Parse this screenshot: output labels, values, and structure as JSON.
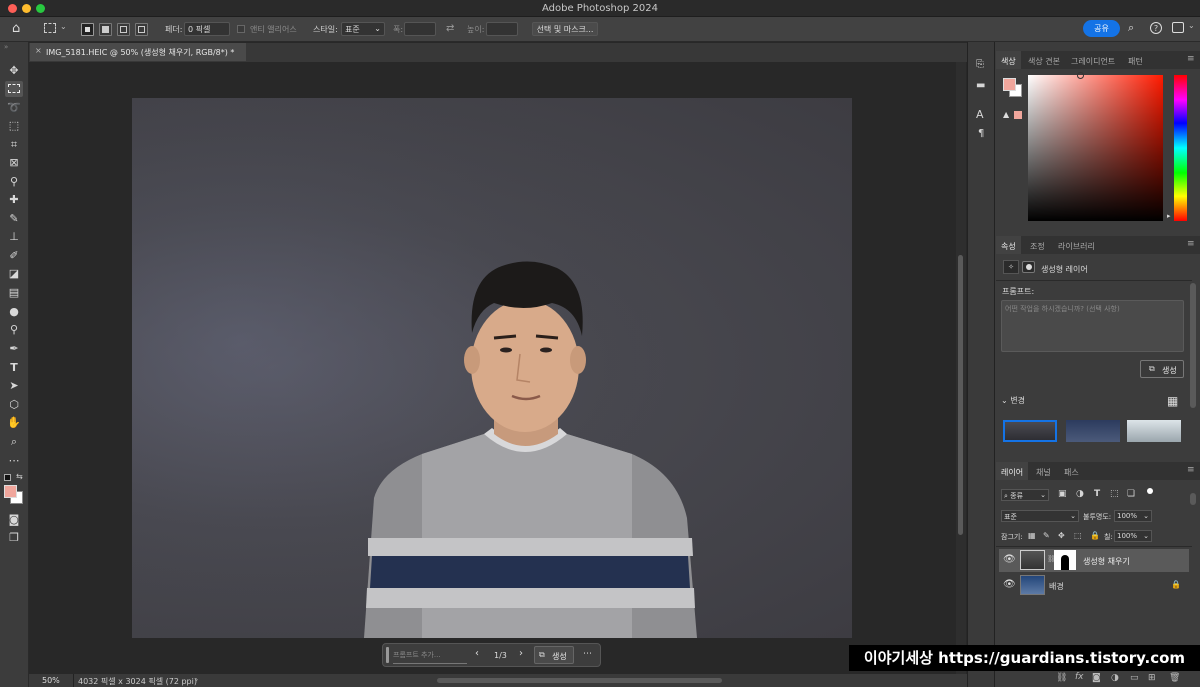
{
  "window": {
    "title": "Adobe Photoshop 2024"
  },
  "options_bar": {
    "feather_label": "페더:",
    "feather_value": "0 픽셀",
    "antialias_label": "앤티 앨리어스",
    "style_label": "스타일:",
    "style_value": "표준",
    "width_label": "폭:",
    "height_label": "높이:",
    "select_mask_label": "선택 및 마스크...",
    "share_label": "공유"
  },
  "document": {
    "tab_label": "IMG_5181.HEIC @ 50% (생성형 채우기, RGB/8*) *",
    "zoom": "50%",
    "info": "4032 픽셀 x 3024 픽셀 (72 ppi)"
  },
  "taskbar": {
    "prompt_placeholder": "프롬프트 추가...",
    "variation_counter": "1/3",
    "generate_label": "생성"
  },
  "color_panel": {
    "tabs": [
      "색상",
      "색상 견본",
      "그레이디언트",
      "패턴"
    ],
    "foreground": "#f0a69c",
    "background": "#ffffff"
  },
  "properties_panel": {
    "tabs": [
      "속성",
      "조정",
      "라이브러리"
    ],
    "layer_type": "생성형 레이어",
    "prompt_label": "프롬프트:",
    "prompt_placeholder": "어떤 작업을 하시겠습니까? (선택 사항)",
    "generate_label": "생성",
    "variations_label": "변경"
  },
  "layers_panel": {
    "tabs": [
      "레이어",
      "채널",
      "패스"
    ],
    "filter_kind": "종류",
    "blend_mode": "표준",
    "opacity_label": "불투명도:",
    "opacity_value": "100%",
    "lock_label": "잠그기:",
    "fill_label": "칠:",
    "fill_value": "100%",
    "layers": [
      {
        "name": "생성형 채우기",
        "selected": true
      },
      {
        "name": "배경",
        "locked": true
      }
    ]
  },
  "watermark": {
    "text": "이야기세상 https://guardians.tistory.com"
  }
}
